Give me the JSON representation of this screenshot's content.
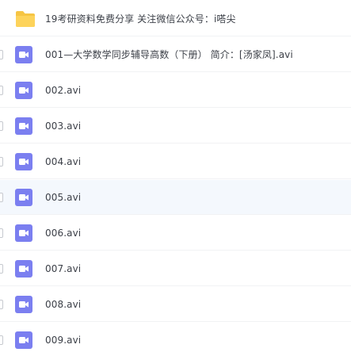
{
  "colors": {
    "folder": "#fdd35b",
    "folder_tab": "#f6c544",
    "video": "#7b7ff0",
    "hover_row": "#f4f8fd",
    "text": "#3b3f47"
  },
  "files": [
    {
      "name": "19考研资料免费分享 关注微信公众号：i嗒尖",
      "icon": "folder-icon"
    },
    {
      "name": "001—大学数学同步辅导高数（下册） 简介：[汤家凤].avi",
      "icon": "video-file-icon"
    },
    {
      "name": "002.avi",
      "icon": "video-file-icon"
    },
    {
      "name": "003.avi",
      "icon": "video-file-icon"
    },
    {
      "name": "004.avi",
      "icon": "video-file-icon"
    },
    {
      "name": "005.avi",
      "icon": "video-file-icon"
    },
    {
      "name": "006.avi",
      "icon": "video-file-icon"
    },
    {
      "name": "007.avi",
      "icon": "video-file-icon"
    },
    {
      "name": "008.avi",
      "icon": "video-file-icon"
    },
    {
      "name": "009.avi",
      "icon": "video-file-icon"
    }
  ]
}
